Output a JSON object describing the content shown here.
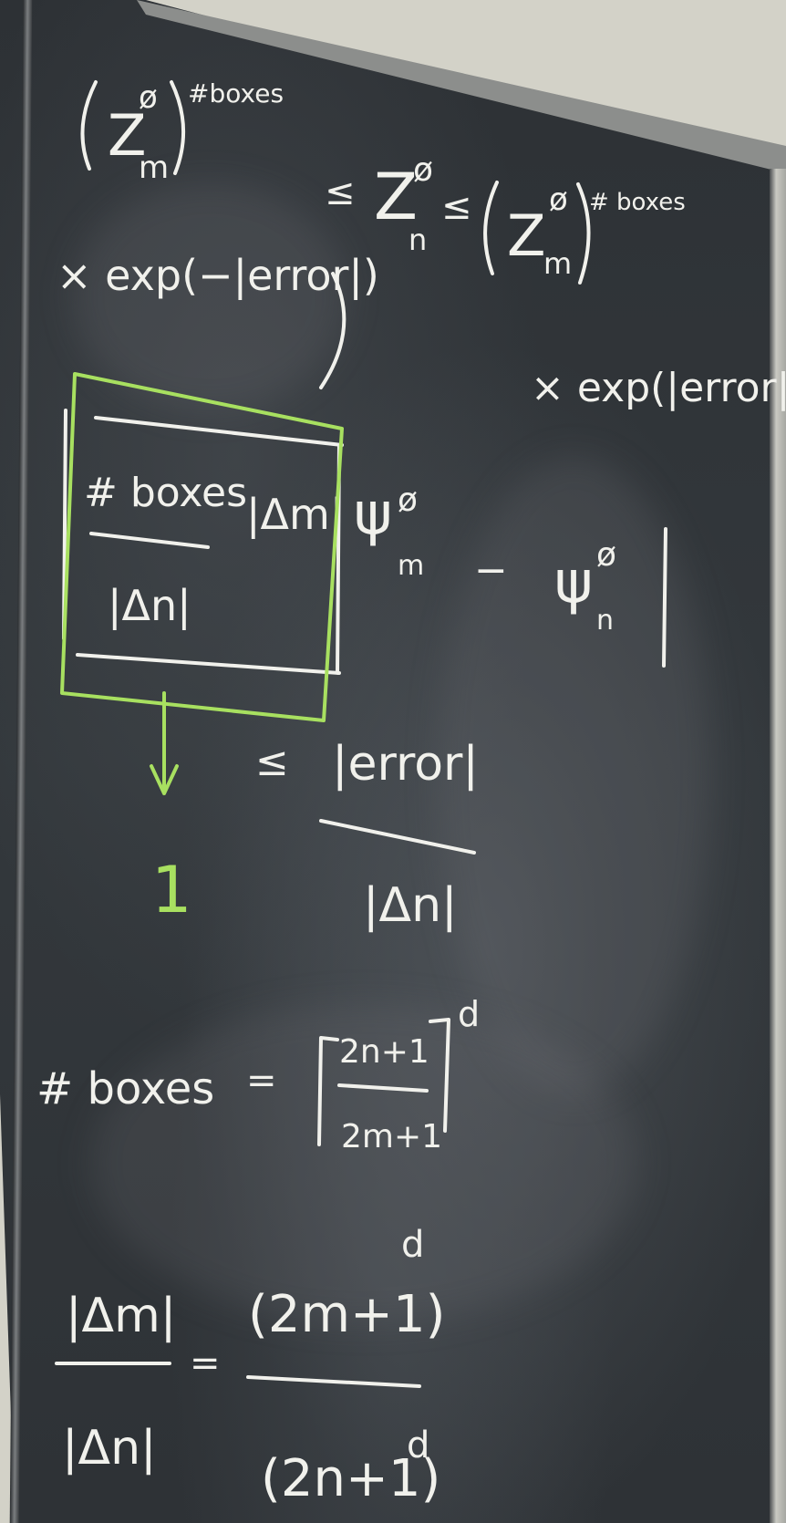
{
  "scene": {
    "description_kind": "chalkboard",
    "colors": {
      "board": "#30353a",
      "chalk": "#f1f1ec",
      "green_chalk": "#a8e060",
      "wall": "#d3d2c8",
      "frame": "#8c8e8c"
    }
  },
  "equation_1": {
    "lhs_base": "Z",
    "lhs_super": "ø",
    "lhs_sub": "m",
    "lhs_exponent": "#boxes",
    "lhs_factor": "× exp(−|error|)",
    "leq_1": "≤",
    "middle_base": "Z",
    "middle_super": "ø",
    "middle_sub": "n",
    "leq_2": "≤",
    "rhs_base": "Z",
    "rhs_super": "ø",
    "rhs_sub": "m",
    "rhs_exponent": "# boxes",
    "rhs_factor": "× exp(|error|)"
  },
  "equation_2": {
    "frac_num": "# boxes",
    "frac_den": "|Δn|",
    "delta_m": "|Δm|",
    "psi_m_base": "ψ",
    "psi_m_super": "ø",
    "psi_m_sub": "m",
    "minus": "−",
    "psi_n_base": "ψ",
    "psi_n_super": "ø",
    "psi_n_sub": "n",
    "green_result": "1",
    "leq": "≤",
    "error_num": "|error|",
    "error_den": "|Δn|"
  },
  "equation_3": {
    "lhs": "# boxes",
    "eq": "=",
    "frac_num": "2n+1",
    "frac_den": "2m+1",
    "exponent": "d"
  },
  "equation_4": {
    "lhs_num": "|Δm|",
    "lhs_den": "|Δn|",
    "eq": "=",
    "rhs_num": "(2m+1)",
    "rhs_num_exp": "d",
    "rhs_den": "(2n+1)",
    "rhs_den_exp": "d"
  }
}
